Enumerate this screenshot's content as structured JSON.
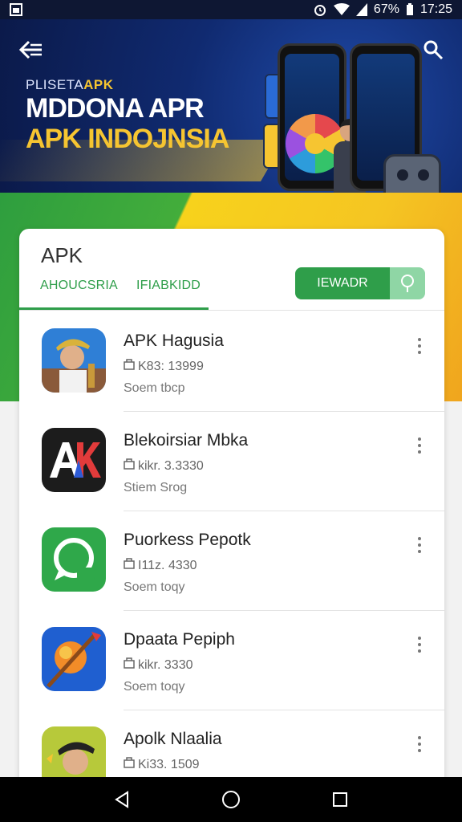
{
  "status_bar": {
    "battery": "67%",
    "time": "17:25"
  },
  "banner": {
    "kicker_a": "PLISETA",
    "kicker_b": "APK",
    "title_line1": "MDDONA APR",
    "title_line2": "APK INDOJNSIA"
  },
  "card": {
    "title": "APK",
    "tabs": [
      "AHOUCSRIA",
      "IFIABKIDD"
    ],
    "action_label": "IEWADR"
  },
  "apps": [
    {
      "name": "APK Hagusia",
      "meta": "K83: 13999",
      "sub": "Soem tbcp"
    },
    {
      "name": "Blekoirsiar Mbka",
      "meta": "kikr. 3.3330",
      "sub": "Stiem Srog"
    },
    {
      "name": "Puorkess Pepotk",
      "meta": "I11z. 4330",
      "sub": "Soem toqy"
    },
    {
      "name": "Dpaata Pepiph",
      "meta": "kikr. 3330",
      "sub": "Soem toqy"
    },
    {
      "name": "Apolk Nlaalia",
      "meta": "Ki33. 1509",
      "sub": ""
    }
  ],
  "colors": {
    "accent": "#2f9e4a",
    "banner_dark": "#0b1a4a",
    "banner_yellow": "#f6c531"
  },
  "icons": [
    "back-icon",
    "search-icon",
    "alarm-icon",
    "wifi-icon",
    "signal-icon",
    "battery-icon",
    "mic-icon",
    "package-icon",
    "more-vert-icon",
    "nav-back-icon",
    "nav-home-icon",
    "nav-recents-icon"
  ]
}
